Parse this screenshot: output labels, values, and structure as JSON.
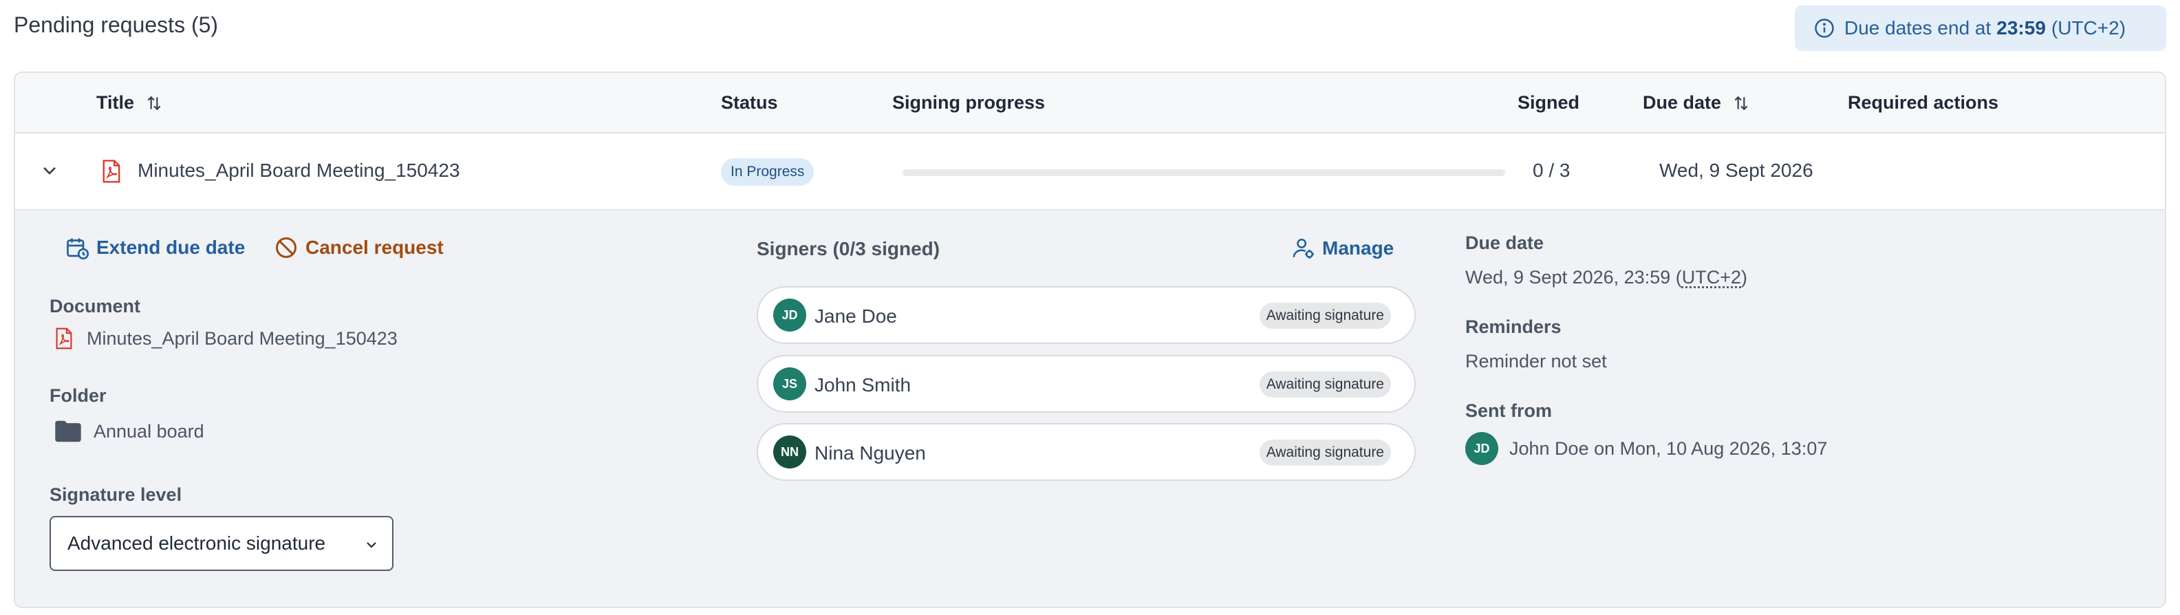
{
  "page": {
    "title": "Pending requests (5)"
  },
  "notice": {
    "prefix": "Due dates end at",
    "time": "23:59",
    "tz": "(UTC+2)",
    "icon": "info-icon"
  },
  "columns": {
    "title": "Title",
    "status": "Status",
    "signing_progress": "Signing progress",
    "signed": "Signed",
    "due_date": "Due date",
    "required_actions": "Required actions"
  },
  "request": {
    "title": "Minutes_April Board Meeting_150423",
    "status": "In Progress",
    "progress_fraction": 0,
    "signed": "0 / 3",
    "due_date": "Wed, 9 Sept 2026",
    "required_actions": ""
  },
  "details": {
    "actions": {
      "extend": "Extend due date",
      "cancel": "Cancel request"
    },
    "document": {
      "label": "Document",
      "value": "Minutes_April Board Meeting_150423"
    },
    "folder": {
      "label": "Folder",
      "value": "Annual board"
    },
    "signature_level": {
      "label": "Signature level",
      "value": "Advanced electronic signature"
    },
    "signers": {
      "title": "Signers (0/3 signed)",
      "manage_label": "Manage",
      "items": [
        {
          "initials": "JD",
          "name": "Jane Doe",
          "status": "Awaiting signature",
          "color": "#1e7d6b"
        },
        {
          "initials": "JS",
          "name": "John Smith",
          "status": "Awaiting signature",
          "color": "#1e7d6b"
        },
        {
          "initials": "NN",
          "name": "Nina Nguyen",
          "status": "Awaiting signature",
          "color": "#17503f"
        }
      ]
    },
    "due": {
      "label": "Due date",
      "value_prefix": "Wed, 9 Sept 2026, 23:59 (",
      "tz": "UTC+2",
      "value_suffix": ")"
    },
    "reminders": {
      "label": "Reminders",
      "value": "Reminder not set"
    },
    "sent_from": {
      "label": "Sent from",
      "initials": "JD",
      "value": "John Doe on Mon, 10 Aug 2026, 13:07",
      "color": "#1e7d6b"
    }
  },
  "colors": {
    "accent": "#23609e",
    "danger": "#a24b10",
    "pdf": "#d93025",
    "panel": "#f0f2f5"
  }
}
